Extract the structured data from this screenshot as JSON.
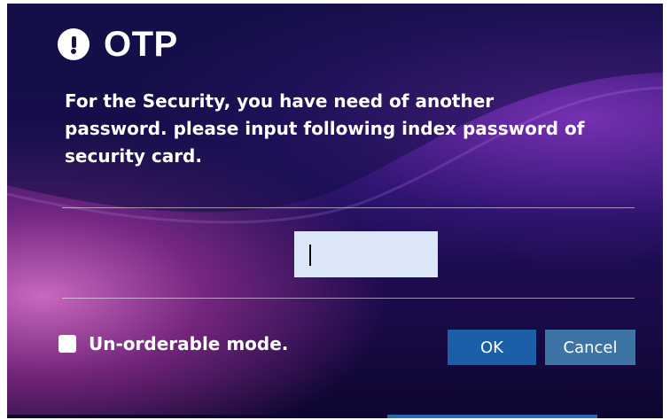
{
  "dialog": {
    "title": "OTP",
    "icon": "exclamation-circle-icon",
    "message": "For the Security, you have need of another password. please input following index password of security card.",
    "otp_input": {
      "value": "",
      "placeholder": ""
    },
    "checkbox": {
      "label": "Un-orderable mode.",
      "checked": false
    },
    "buttons": {
      "ok": "OK",
      "cancel": "Cancel"
    },
    "colors": {
      "background": "#1a0f55",
      "accent_pink": "#e678d2",
      "accent_purple": "#965ad2",
      "input_bg": "#dbe6f8",
      "ok_button": "#1b5fa8",
      "cancel_button": "#3e73a6"
    }
  }
}
